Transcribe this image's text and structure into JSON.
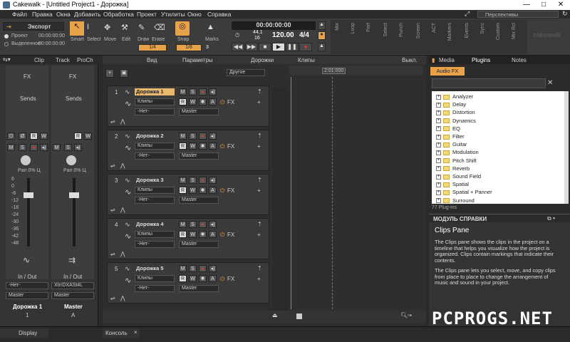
{
  "window": {
    "title": "Cakewalk - [Untitled Project1 - Дорожка]",
    "min": "—",
    "max": "□",
    "close": "✕"
  },
  "menu": [
    "Файл",
    "Правка",
    "Окна",
    "Добавить",
    "Обработка",
    "Проект",
    "Утилиты",
    "Окно",
    "Справка"
  ],
  "workspace": "Перспективы",
  "toolbar": {
    "export": "Экспорт",
    "radio_project": "Проект",
    "radio_selection": "Выделенное",
    "time1": "00:00:00:00",
    "time2": "00:00:00:00",
    "tools": [
      "Smart",
      "Select",
      "Move",
      "Edit",
      "Draw",
      "Erase"
    ],
    "snap": "Snap",
    "marks": "Marks",
    "snap_val1": "1/4",
    "snap_val2": "1/8",
    "snap_num": "3",
    "main_time": "00:00:00:00",
    "rate1": "44,1",
    "rate2": "16",
    "tempo": "120.00",
    "meter": "4/4",
    "mode_label": "Режим",
    "modules": [
      "Mix",
      "Loop",
      "Perf",
      "Select",
      "Punch",
      "Screen",
      "ACT",
      "Markers",
      "Events",
      "Sync",
      "Custom",
      "Mix Rcl"
    ],
    "brand": "cakewalk"
  },
  "left": {
    "tabs": [
      "Clip",
      "Track",
      "ProCh"
    ],
    "fx": "FX",
    "sends": "Sends",
    "pan": "Pan 0% Ц",
    "scale": [
      "6",
      "0",
      "-6",
      "-12",
      "-18",
      "-24",
      "-30",
      "-36",
      "-42",
      "-48",
      "-54"
    ],
    "inout": "In / Out",
    "in1": "-Нет-",
    "in2": "XtrrDXASt4L",
    "out1": "Master",
    "out2": "Master",
    "name1": "Дорожка 1",
    "name2": "Master",
    "num1": "1",
    "num2": "A",
    "display": "Display"
  },
  "track_header": {
    "view": "Вид",
    "params": "Параметры",
    "tracks": "Дорожки",
    "clips": "Клипы",
    "off": "Выкл.",
    "position": "2:01:000",
    "other": "Другое"
  },
  "tracks": [
    {
      "num": "1",
      "name": "Дорожка 1",
      "clips": "Клипы",
      "input": "-Нет-",
      "output": "Master",
      "fx": "FX"
    },
    {
      "num": "2",
      "name": "Дорожка 2",
      "clips": "Клипы",
      "input": "-Нет-",
      "output": "Master",
      "fx": "FX"
    },
    {
      "num": "3",
      "name": "Дорожка 3",
      "clips": "Клипы",
      "input": "-Нет-",
      "output": "Master",
      "fx": "FX"
    },
    {
      "num": "4",
      "name": "Дорожка 4",
      "clips": "Клипы",
      "input": "-Нет-",
      "output": "Master",
      "fx": "FX"
    },
    {
      "num": "5",
      "name": "Дорожка 5",
      "clips": "Клипы",
      "input": "-Нет-",
      "output": "Master",
      "fx": "FX"
    }
  ],
  "btn": {
    "m": "M",
    "s": "S",
    "r": "R",
    "w": "W",
    "a": "A"
  },
  "right": {
    "tabs": [
      "Media",
      "Plugins",
      "Notes"
    ],
    "subtab": "Audio FX",
    "plugins": [
      "Analyzer",
      "Delay",
      "Distortion",
      "Dynamics",
      "EQ",
      "Filter",
      "Guitar",
      "Modulation",
      "Pitch Shift",
      "Reverb",
      "Sound Field",
      "Spatial",
      "Spatial + Panner",
      "Surround"
    ],
    "count": "77 Plug-ins",
    "help_header": "МОДУЛЬ СПРАВКИ",
    "help_title": "Clips Pane",
    "help_p1": "The Clips pane shows the clips in the project on a timeline that helps you visualize how the project is organized. Clips contain markings that indicate their contents.",
    "help_p2": "The Clips pane lets you select, move, and copy clips from place to place to change the arrangement of music and sound in your project."
  },
  "bottom": {
    "console": "Консоль",
    "watermark": "PCPROGS.NET",
    "close": "×"
  }
}
